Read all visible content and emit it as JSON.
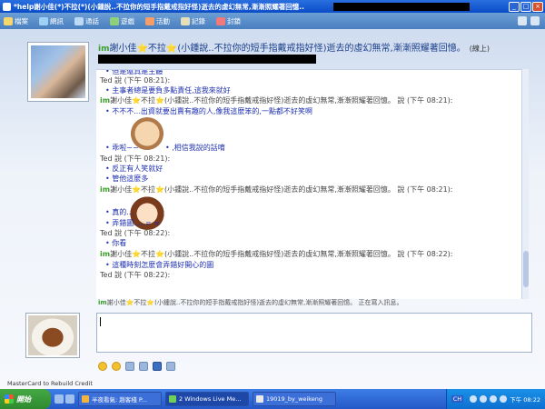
{
  "window": {
    "title": "*help謝小佳(*)不拉(*)(小鍾說..不拉你的短手指戴戒指好怪)逝去的虛幻無常,漸漸照耀著回憶.."
  },
  "toolbar": {
    "items": [
      "檔案",
      "網訊",
      "通話",
      "遊戲",
      "活動",
      "記錄",
      "封鎖"
    ]
  },
  "contact": {
    "im_tag": "im",
    "name": "謝小佳⭐不拉⭐(小鍾說..不拉你的短手指戴戒指好怪)逝去的虛幻無常,漸漸照耀著回憶。",
    "status": "(線上)"
  },
  "chat": {
    "top_partial": "但是還真是主體",
    "messages": [
      {
        "type": "speaker",
        "text": "Ted 說 (下午 08:21):"
      },
      {
        "type": "line",
        "text": "主事者總是要負多點責任,這我來就好"
      },
      {
        "type": "nick",
        "text": "謝小佳⭐不拉⭐(小鍾說..不拉你的短手指戴戒指好怪)逝去的虛幻無常,漸漸照耀著回憶。 說 (下午 08:21):"
      },
      {
        "type": "line",
        "text": "不不不...出資就要出賣有趣的人,像我這麼笨的,一點都不好笑啊"
      },
      {
        "type": "line",
        "text": "乖啦~~"
      },
      {
        "type": "line",
        "text": ",相信我說的話唷"
      },
      {
        "type": "speaker",
        "text": "Ted 說 (下午 08:21):"
      },
      {
        "type": "line",
        "text": "反正有人笑就好"
      },
      {
        "type": "line",
        "text": "管他這麼多"
      },
      {
        "type": "nick",
        "text": "謝小佳⭐不拉⭐(小鍾說..不拉你的短手指戴戒指好怪)逝去的虛幻無常,漸漸照耀著回憶。 說 (下午 08:21):"
      },
      {
        "type": "line",
        "text": "真的..."
      },
      {
        "type": "line",
        "text": "弄錯圖.....= ="
      },
      {
        "type": "speaker",
        "text": "Ted 說 (下午 08:22):"
      },
      {
        "type": "line",
        "text": "你看"
      },
      {
        "type": "nick",
        "text": "謝小佳⭐不拉⭐(小鍾說..不拉你的短手指戴戒指好怪)逝去的虛幻無常,漸漸照耀著回憶。 說 (下午 08:22):"
      },
      {
        "type": "line",
        "text": "這種時刻怎麼會弄錯好開心的圖"
      },
      {
        "type": "speaker",
        "text": "Ted 說 (下午 08:22):"
      }
    ]
  },
  "typing_status": "謝小佳⭐不拉⭐(小鍾說..不拉你的短手指戴戒指好怪)逝去的虛幻無常,漸漸照耀著回憶。 正在寫入訊息。",
  "footer_text": "MasterCard to Rebuild Credit",
  "taskbar": {
    "start": "開始",
    "tasks": [
      "半夜看氣: 趙客棧 P...",
      "2 Windows Live Me...",
      "19019_by_weikeng"
    ],
    "lang": "CH",
    "clock": "下午 08:22"
  }
}
